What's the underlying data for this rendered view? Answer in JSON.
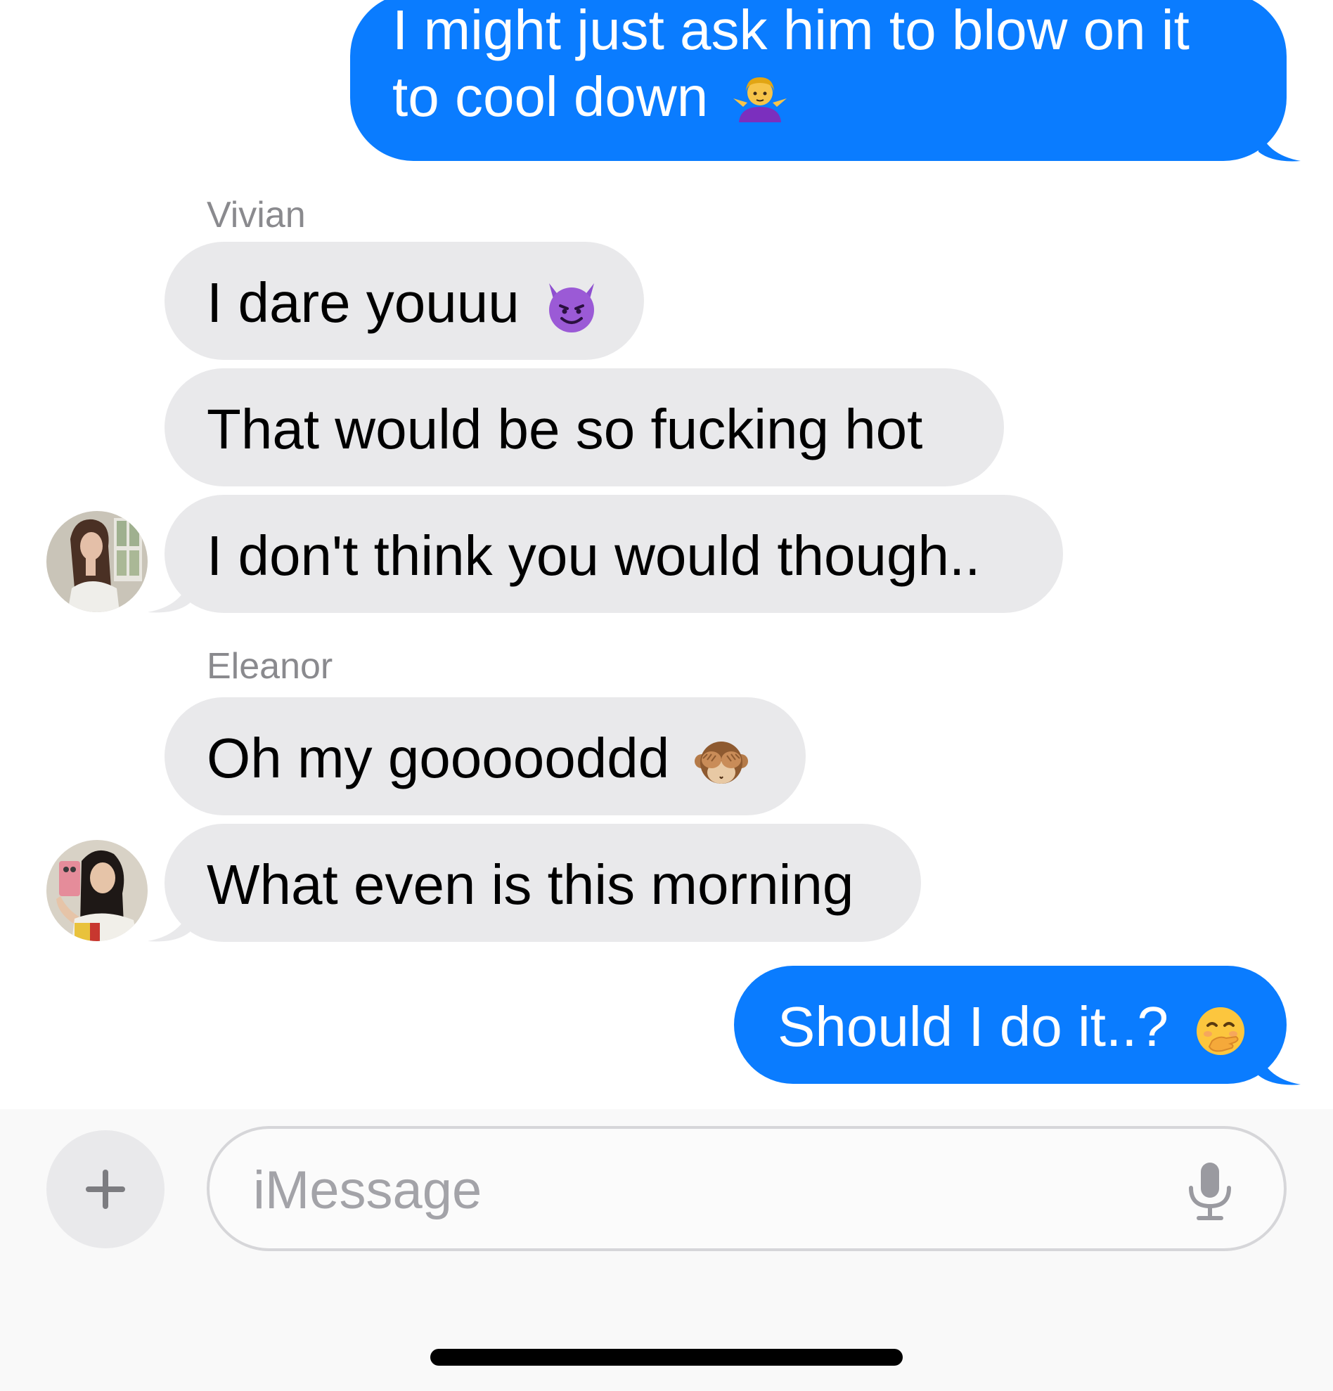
{
  "conversation": {
    "messages": [
      {
        "direction": "outgoing",
        "lines": [
          "I might just ask him to blow on it",
          "to cool down"
        ],
        "emoji": "person-shrugging-emoji"
      },
      {
        "direction": "incoming",
        "sender": "Vivian",
        "text": "I dare youuu",
        "emoji": "smiling-devil-emoji"
      },
      {
        "direction": "incoming",
        "sender": "Vivian",
        "text": "That would be so fucking hot"
      },
      {
        "direction": "incoming",
        "sender": "Vivian",
        "text": "I don't think you would though..",
        "avatar": "vivian-avatar"
      },
      {
        "direction": "incoming",
        "sender": "Eleanor",
        "text": "Oh my goooooddd",
        "emoji": "see-no-evil-monkey-emoji"
      },
      {
        "direction": "incoming",
        "sender": "Eleanor",
        "text": "What even is this morning",
        "avatar": "eleanor-avatar"
      },
      {
        "direction": "outgoing",
        "text": "Should I do it..?",
        "emoji": "face-with-hand-over-mouth-emoji"
      }
    ],
    "sender_labels": {
      "vivian": "Vivian",
      "eleanor": "Eleanor"
    }
  },
  "compose": {
    "placeholder": "iMessage",
    "plus_icon": "plus-icon",
    "mic_icon": "microphone-icon"
  },
  "colors": {
    "outgoing_bubble": "#0a7cff",
    "incoming_bubble": "#e9e9eb",
    "sender_label": "#8a8a8e",
    "placeholder": "#a3a3a8"
  }
}
